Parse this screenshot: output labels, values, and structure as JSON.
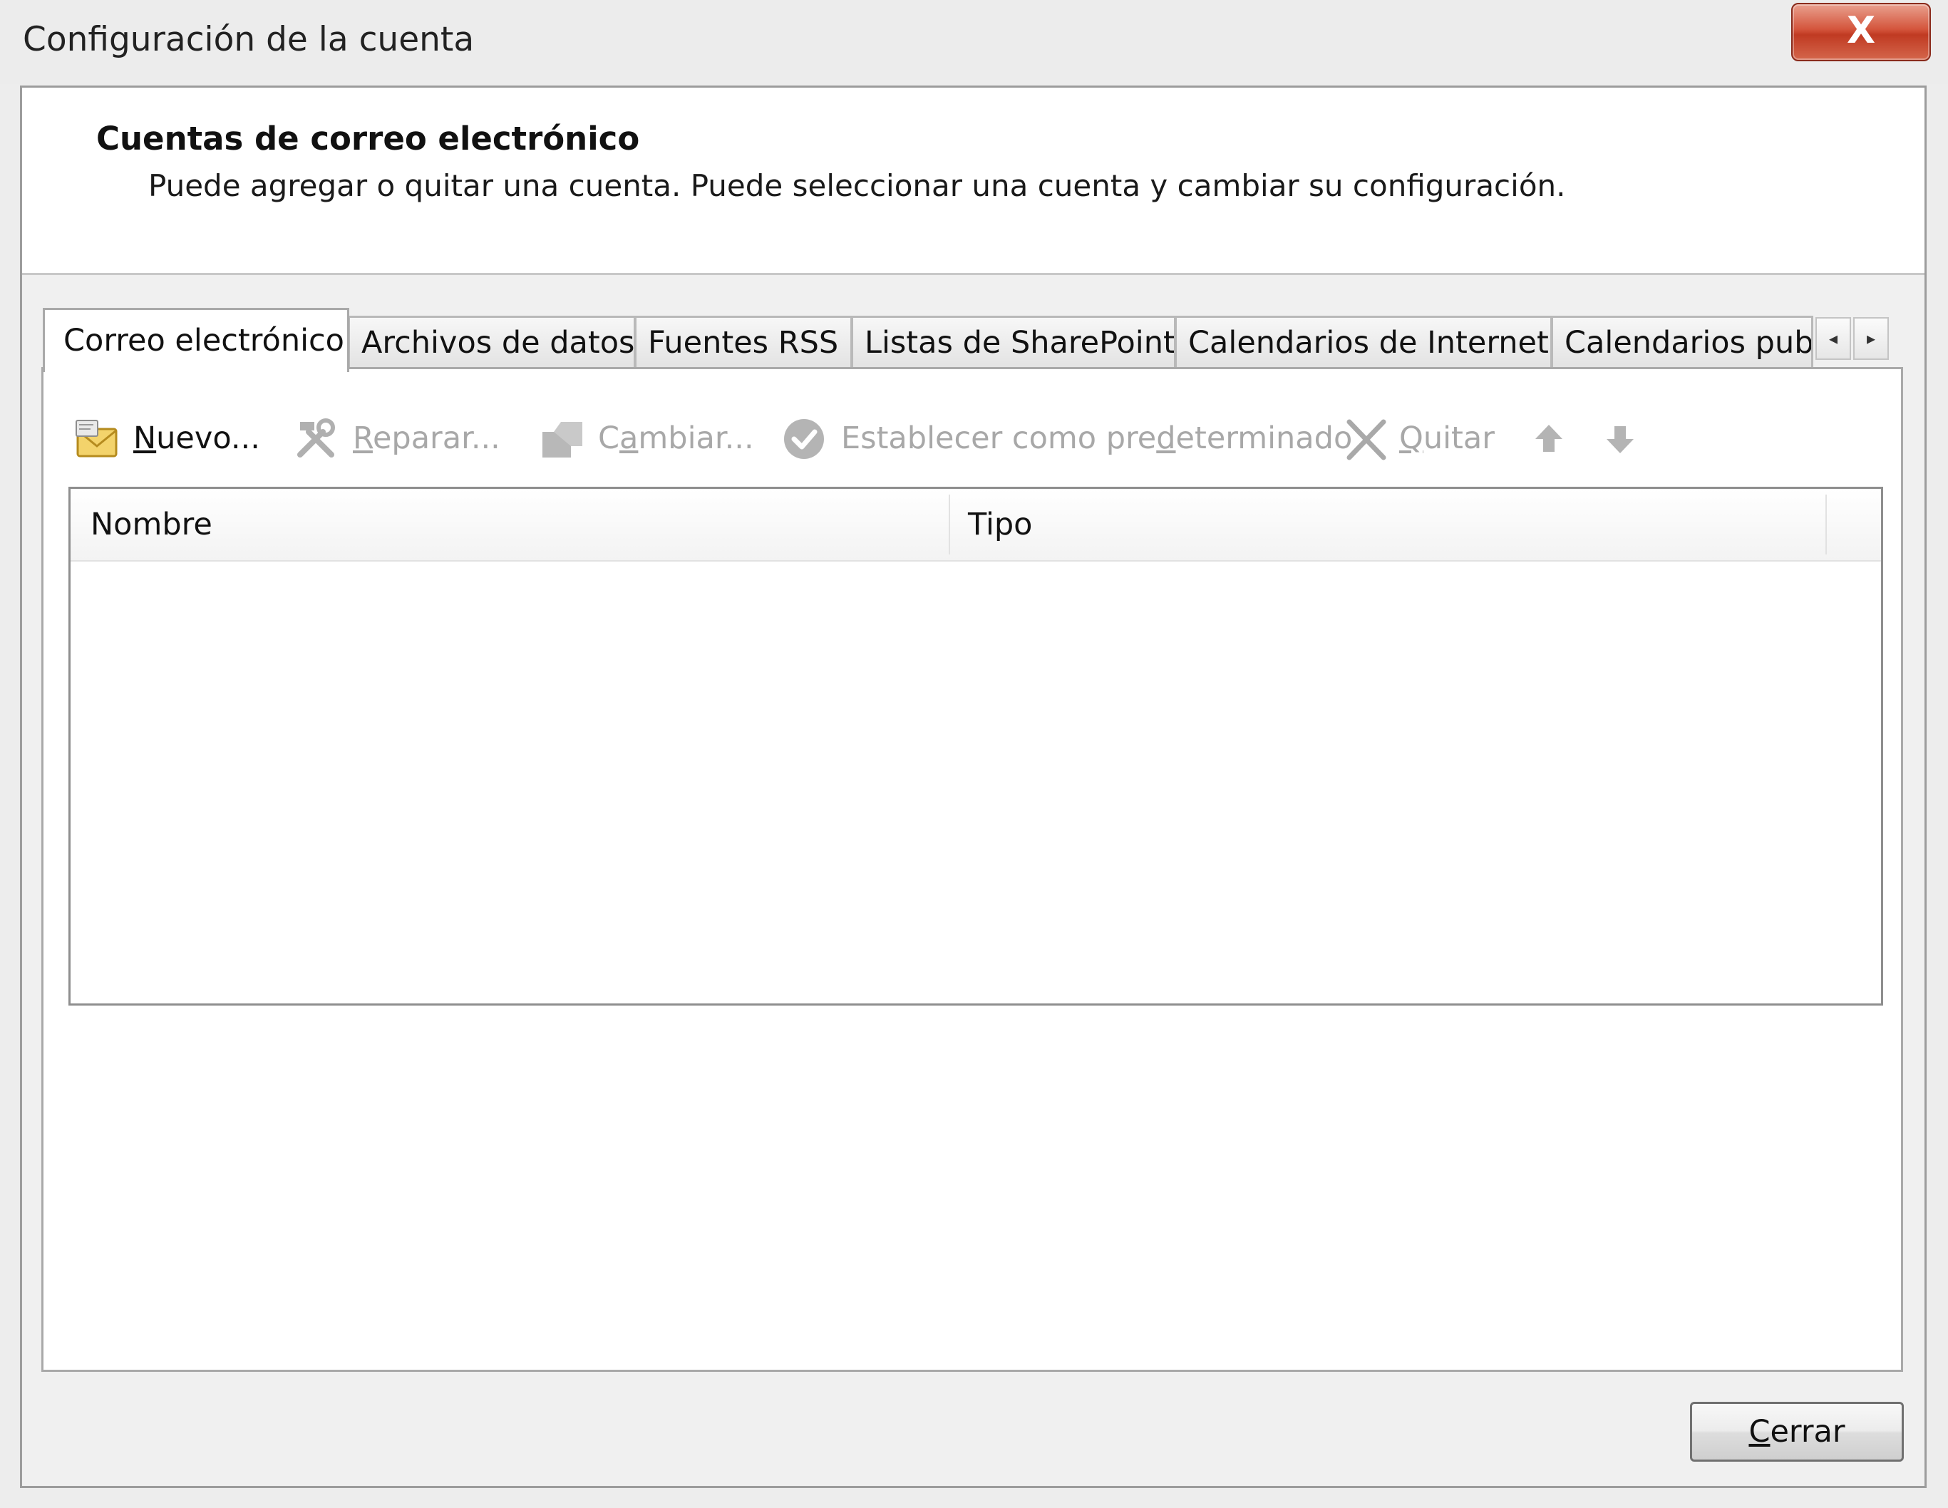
{
  "window": {
    "title": "Configuración de la cuenta",
    "close_glyph": "X"
  },
  "header": {
    "title": "Cuentas de correo electrónico",
    "description": "Puede agregar o quitar una cuenta. Puede seleccionar una cuenta y cambiar su configuración."
  },
  "tabs": [
    {
      "label": "Correo electrónico",
      "active": true
    },
    {
      "label": "Archivos de datos",
      "active": false
    },
    {
      "label": "Fuentes RSS",
      "active": false
    },
    {
      "label": "Listas de SharePoint",
      "active": false
    },
    {
      "label": "Calendarios de Internet",
      "active": false
    },
    {
      "label": "Calendarios publi",
      "active": false
    }
  ],
  "tab_scroll": {
    "left_glyph": "◂",
    "right_glyph": "▸"
  },
  "toolbar": {
    "new": {
      "mnemonic": "N",
      "rest": "uevo...",
      "icon": "new-account-envelope-icon",
      "enabled": true
    },
    "repair": {
      "mnemonic": "R",
      "rest": "eparar...",
      "icon": "repair-tools-icon",
      "enabled": false
    },
    "change": {
      "pre": "C",
      "mnemonic": "a",
      "rest": "mbiar...",
      "icon": "change-icon",
      "enabled": false
    },
    "default": {
      "pre": "Establecer como pre",
      "mnemonic": "d",
      "rest": "eterminado",
      "icon": "check-circle-icon",
      "enabled": false
    },
    "remove": {
      "mnemonic": "Q",
      "rest": "uitar",
      "icon": "x-remove-icon",
      "enabled": false
    },
    "move_up": {
      "icon": "arrow-up-icon",
      "enabled": false
    },
    "move_down": {
      "icon": "arrow-down-icon",
      "enabled": false
    }
  },
  "accounts_list": {
    "columns": [
      "Nombre",
      "Tipo"
    ],
    "rows": []
  },
  "footer": {
    "close": {
      "mnemonic": "C",
      "rest": "errar"
    }
  },
  "colors": {
    "close_red": "#c8462d",
    "disabled_text": "#a8a8a8",
    "background": "#f0f0f0"
  }
}
